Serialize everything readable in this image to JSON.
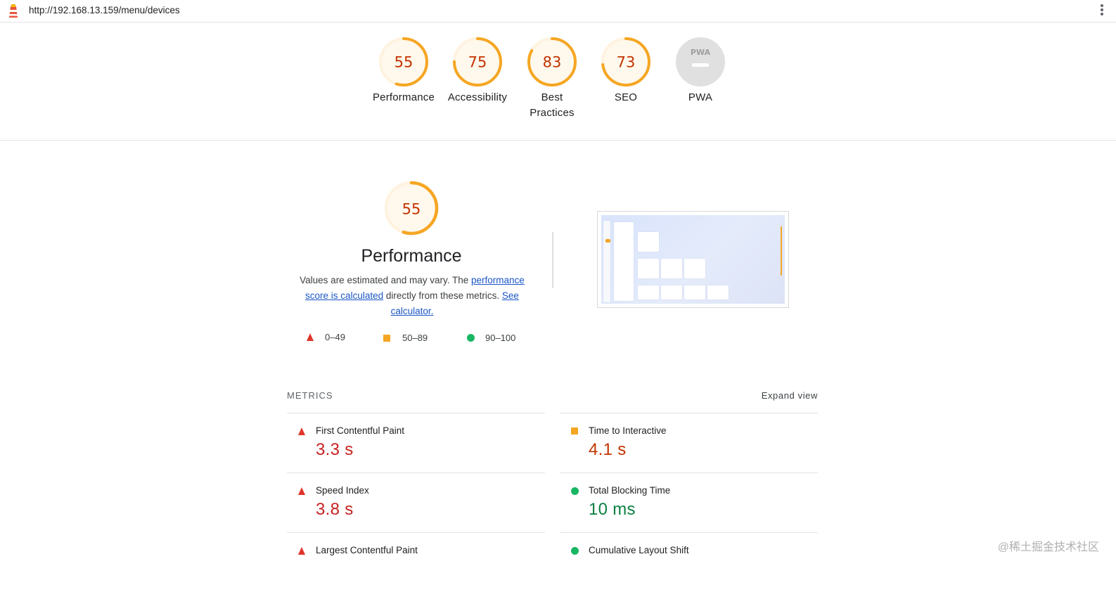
{
  "url": "http://192.168.13.159/menu/devices",
  "icons": {
    "logo": "lighthouse-icon",
    "menu": "kebab-menu-icon"
  },
  "colors": {
    "fail": "#e0352b",
    "average": "#f5a623",
    "pass": "#18b663"
  },
  "gauges": [
    {
      "score": "55",
      "label": "Performance",
      "fraction": 0.55
    },
    {
      "score": "75",
      "label": "Accessibility",
      "fraction": 0.75
    },
    {
      "score": "83",
      "label": "Best Practices",
      "fraction": 0.83
    },
    {
      "score": "73",
      "label": "SEO",
      "fraction": 0.73
    },
    {
      "score": "",
      "label": "PWA",
      "icon": "pwa-icon"
    }
  ],
  "performance": {
    "score": "55",
    "fraction": 0.55,
    "title": "Performance",
    "desc_text1": "Values are estimated and may vary. The ",
    "desc_link1": "performance score is calculated",
    "desc_text2": " directly from these metrics. ",
    "desc_link2": "See calculator."
  },
  "legend": [
    {
      "shape": "triangle",
      "label": "0–49"
    },
    {
      "shape": "square",
      "label": "50–89"
    },
    {
      "shape": "circle",
      "label": "90–100"
    }
  ],
  "metrics": {
    "header": "METRICS",
    "expand_label": "Expand view",
    "left": [
      {
        "name": "First Contentful Paint",
        "value": "3.3 s",
        "status": "fail"
      },
      {
        "name": "Speed Index",
        "value": "3.8 s",
        "status": "fail"
      },
      {
        "name": "Largest Contentful Paint",
        "value": "",
        "status": "fail"
      }
    ],
    "right": [
      {
        "name": "Time to Interactive",
        "value": "4.1 s",
        "status": "average"
      },
      {
        "name": "Total Blocking Time",
        "value": "10 ms",
        "status": "pass"
      },
      {
        "name": "Cumulative Layout Shift",
        "value": "",
        "status": "pass"
      }
    ]
  },
  "watermark": "@稀土掘金技术社区"
}
